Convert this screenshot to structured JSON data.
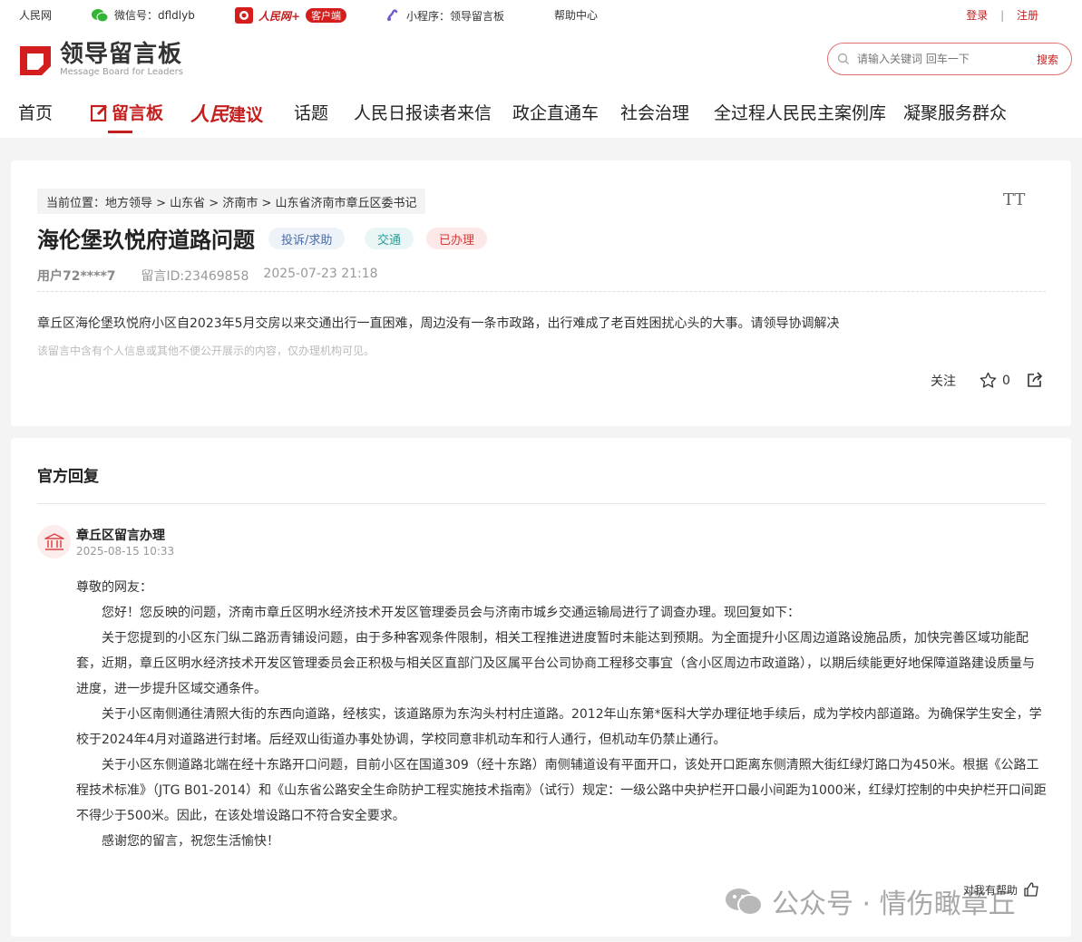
{
  "topbar": {
    "site": "人民网",
    "wechat": "微信号：dfldlyb",
    "app_name": "人民网+",
    "app_badge": "客户端",
    "miniprogram": "小程序：领导留言板",
    "help": "帮助中心",
    "login": "登录",
    "divider": "|",
    "register": "注册"
  },
  "logo": {
    "title": "领导留言板",
    "subtitle": "Message Board for Leaders"
  },
  "search": {
    "placeholder": "请输入关键词 回车一下",
    "button": "搜索"
  },
  "nav": {
    "items": [
      "首页",
      "留言板",
      "人民建议",
      "话题",
      "人民日报读者来信",
      "政企直通车",
      "社会治理",
      "全过程人民民主案例库",
      "凝聚服务群众"
    ],
    "brand_prefix": "人民",
    "brand_suffix": "建议"
  },
  "post": {
    "breadcrumb": "当前位置：地方领导 > 山东省 > 济南市 > 山东省济南市章丘区委书记",
    "font_toggle": "TT",
    "title": "海伦堡玖悦府道路问题",
    "tags": [
      "投诉/求助",
      "交通",
      "已办理"
    ],
    "user": "用户72****7",
    "message_id": "留言ID:23469858",
    "time": "2025-07-23 21:18",
    "content": "章丘区海伦堡玖悦府小区自2023年5月交房以来交通出行一直困难，周边没有一条市政路，出行难成了老百姓困扰心头的大事。请领导协调解决",
    "privacy_note": "该留言中含有个人信息或其他不便公开展示的内容，仅办理机构可见。",
    "follow": "关注",
    "like_count": "0"
  },
  "reply": {
    "section_title": "官方回复",
    "org": "章丘区留言办理",
    "date": "2025-08-15 10:33",
    "paragraphs": [
      "尊敬的网友：",
      "您好！您反映的问题，济南市章丘区明水经济技术开发区管理委员会与济南市城乡交通运输局进行了调查办理。现回复如下：",
      "关于您提到的小区东门纵二路沥青铺设问题，由于多种客观条件限制，相关工程推进进度暂时未能达到预期。为全面提升小区周边道路设施品质，加快完善区域功能配套，近期，章丘区明水经济技术开发区管理委员会正积极与相关区直部门及区属平台公司协商工程移交事宜（含小区周边市政道路），以期后续能更好地保障道路建设质量与进度，进一步提升区域交通条件。",
      "关于小区南侧通往清照大街的东西向道路，经核实，该道路原为东沟头村村庄道路。2012年山东第*医科大学办理征地手续后，成为学校内部道路。为确保学生安全，学校于2024年4月对道路进行封堵。后经双山街道办事处协调，学校同意非机动车和行人通行，但机动车仍禁止通行。",
      "关于小区东侧道路北端在经十东路开口问题，目前小区在国道309（经十东路）南侧辅道设有平面开口，该处开口距离东侧清照大街红绿灯路口为450米。根据《公路工程技术标准》（JTG B01-2014）和《山东省公路安全生命防护工程实施技术指南》（试行）规定：一级公路中央护栏开口最小间距为1000米，红绿灯控制的中央护栏开口间距不得少于500米。因此，在该处增设路口不符合安全要求。",
      "感谢您的留言，祝您生活愉快！"
    ],
    "helpful": "对我有帮助"
  },
  "watermark": "公众号 · 情伤瞰章丘",
  "colors": {
    "brand_red": "#c41e1e",
    "tag_blue": "#4a6ca8",
    "tag_teal": "#2b9e96",
    "tag_red": "#d43b3b"
  }
}
